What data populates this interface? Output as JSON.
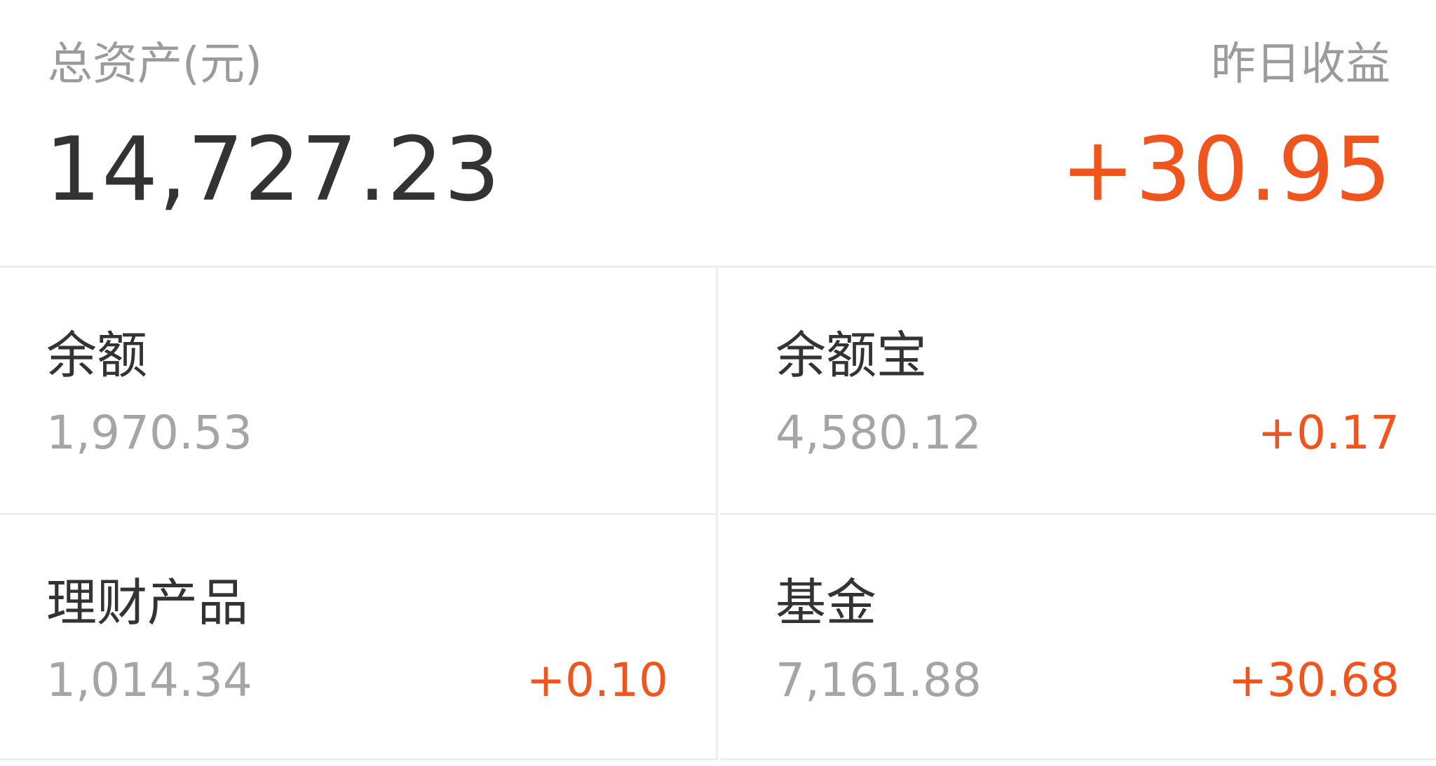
{
  "summary": {
    "total_assets_label": "总资产(元)",
    "total_assets_value": "14,727.23",
    "yesterday_earnings_label": "昨日收益",
    "yesterday_earnings_value": "+30.95"
  },
  "accounts": [
    {
      "name": "余额",
      "amount": "1,970.53",
      "yield": ""
    },
    {
      "name": "余额宝",
      "amount": "4,580.12",
      "yield": "+0.17"
    },
    {
      "name": "理财产品",
      "amount": "1,014.34",
      "yield": "+0.10"
    },
    {
      "name": "基金",
      "amount": "7,161.88",
      "yield": "+30.68"
    }
  ],
  "colors": {
    "accent": "#f0551e",
    "primary_text": "#333333",
    "secondary_text": "#9b9b9b",
    "divider": "#eeeeee"
  }
}
